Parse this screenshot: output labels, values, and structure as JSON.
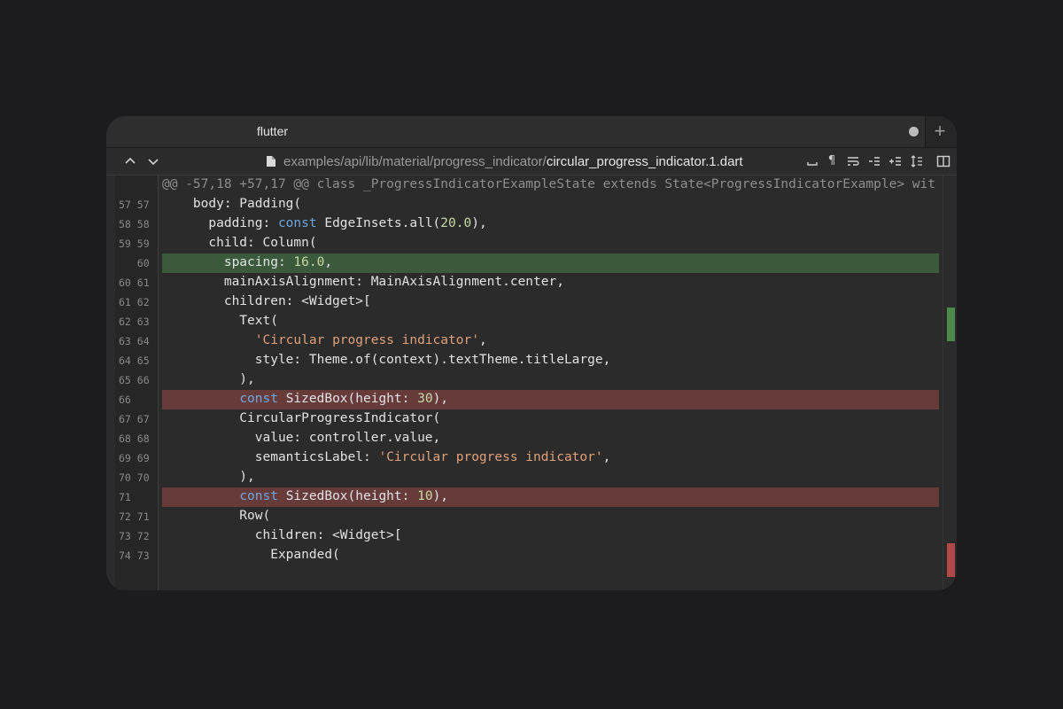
{
  "tab": {
    "title": "flutter"
  },
  "toolbar": {
    "path_dir": "examples/api/lib/material/progress_indicator/",
    "path_file": "circular_progress_indicator.1.dart"
  },
  "hunk_header": "@@ -57,18 +57,17 @@ class _ProgressIndicatorExampleState extends State<ProgressIndicatorExample> wit",
  "lines": [
    {
      "nums": "57 57",
      "code": "    body: Padding(",
      "type": "ctx"
    },
    {
      "nums": "58 58",
      "code": "      padding: const EdgeInsets.all(20.0),",
      "type": "ctx"
    },
    {
      "nums": "59 59",
      "code": "      child: Column(",
      "type": "ctx"
    },
    {
      "nums": "   60",
      "code": "        spacing: 16.0,",
      "type": "add"
    },
    {
      "nums": "60 61",
      "code": "        mainAxisAlignment: MainAxisAlignment.center,",
      "type": "ctx"
    },
    {
      "nums": "61 62",
      "code": "        children: <Widget>[",
      "type": "ctx"
    },
    {
      "nums": "62 63",
      "code": "          Text(",
      "type": "ctx"
    },
    {
      "nums": "63 64",
      "code": "            'Circular progress indicator',",
      "type": "ctx"
    },
    {
      "nums": "64 65",
      "code": "            style: Theme.of(context).textTheme.titleLarge,",
      "type": "ctx"
    },
    {
      "nums": "65 66",
      "code": "          ),",
      "type": "ctx"
    },
    {
      "nums": "66   ",
      "code": "          const SizedBox(height: 30),",
      "type": "del"
    },
    {
      "nums": "67 67",
      "code": "          CircularProgressIndicator(",
      "type": "ctx"
    },
    {
      "nums": "68 68",
      "code": "            value: controller.value,",
      "type": "ctx"
    },
    {
      "nums": "69 69",
      "code": "            semanticsLabel: 'Circular progress indicator',",
      "type": "ctx"
    },
    {
      "nums": "70 70",
      "code": "          ),",
      "type": "ctx"
    },
    {
      "nums": "71   ",
      "code": "          const SizedBox(height: 10),",
      "type": "del"
    },
    {
      "nums": "72 71",
      "code": "          Row(",
      "type": "ctx"
    },
    {
      "nums": "73 72",
      "code": "            children: <Widget>[",
      "type": "ctx"
    },
    {
      "nums": "74 73",
      "code": "              Expanded(",
      "type": "ctx"
    }
  ],
  "colors": {
    "added_bg": "#3b5a3b",
    "removed_bg": "#683b3b",
    "keyword": "#6ea8e0",
    "string": "#e0a17a",
    "number": "#c9d9a6"
  },
  "icons": [
    "chevron-up-icon",
    "chevron-down-icon",
    "file-icon",
    "whitespace-icon",
    "pilcrow-icon",
    "wrap-icon",
    "collapse-icon",
    "expand-icon",
    "fold-icon",
    "split-view-icon"
  ]
}
